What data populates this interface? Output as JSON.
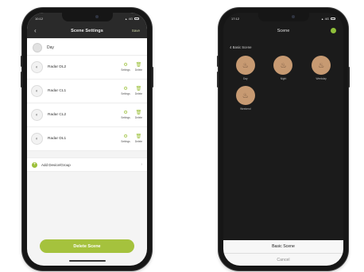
{
  "left_phone": {
    "status": {
      "time": "10:12",
      "carrier": "4G"
    },
    "nav": {
      "back": "‹",
      "title": "Scene Settings",
      "action": "Save"
    },
    "scene_name": "Day",
    "devices": [
      {
        "name": "Radar DL2",
        "settings": "Settings",
        "delete": "Delete"
      },
      {
        "name": "Radar CL1",
        "settings": "Settings",
        "delete": "Delete"
      },
      {
        "name": "Radar CL2",
        "settings": "Settings",
        "delete": "Delete"
      },
      {
        "name": "Radar DL1",
        "settings": "Settings",
        "delete": "Delete"
      }
    ],
    "add_label": "Add Device/Group",
    "delete_button": "Delete Scene"
  },
  "right_phone": {
    "status": {
      "time": "17:12",
      "carrier": "4G"
    },
    "title": "Scene",
    "section": "4 Basic Scene",
    "scenes": [
      {
        "label": "Day"
      },
      {
        "label": "Night"
      },
      {
        "label": "Weekday"
      },
      {
        "label": "Weekend"
      }
    ],
    "sheet": {
      "primary": "Basic Scene",
      "cancel": "Cancel"
    }
  },
  "colors": {
    "accent": "#a5c23d",
    "scene_circle": "#c79a72",
    "dark_bg": "#1b1b1b"
  },
  "icons": {
    "back": "chevron-left-icon",
    "device": "radar-sensor-icon",
    "settings": "gear-icon",
    "delete": "trash-icon",
    "add": "plus-circle-icon",
    "scene": "lamp-icon"
  }
}
